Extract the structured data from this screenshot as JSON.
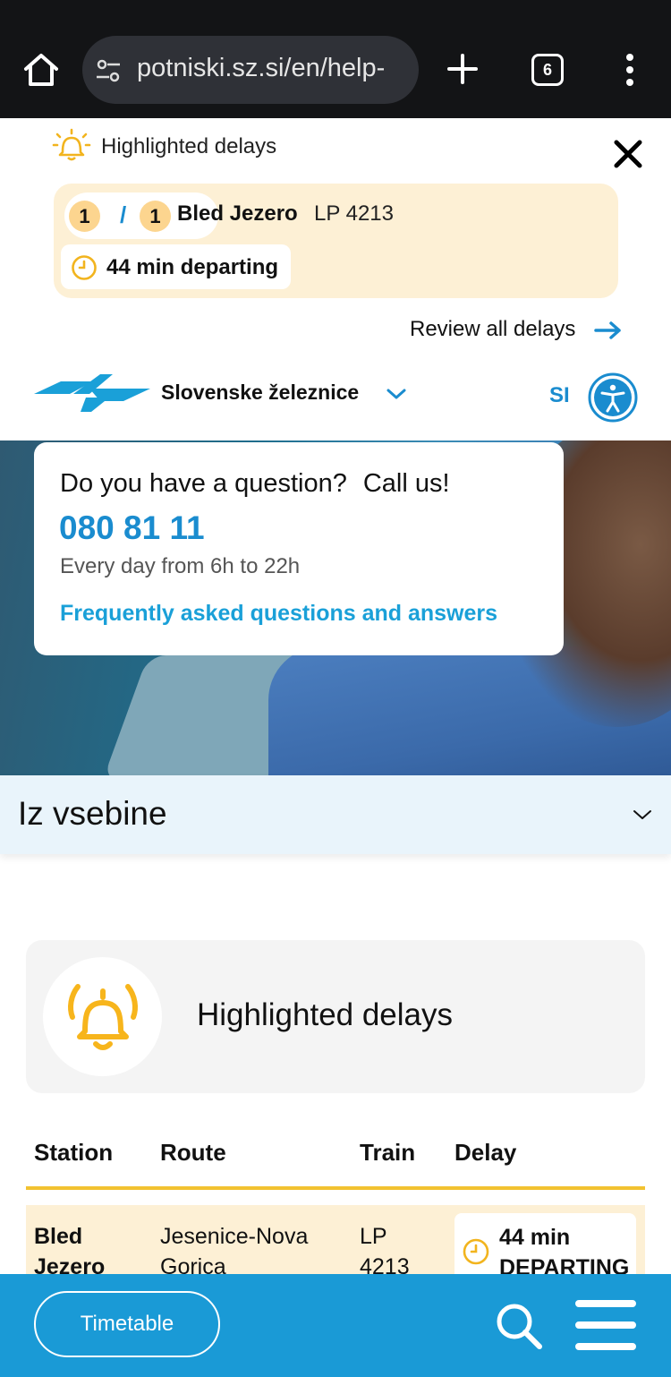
{
  "browser": {
    "url": "potniski.sz.si/en/help-",
    "tab_count": "6"
  },
  "banner": {
    "title": "Highlighted delays",
    "pager_current": "1",
    "pager_separator": "/",
    "pager_total": "1",
    "station": "Bled Jezero",
    "train": "LP 4213",
    "status": "44 min departing",
    "review_link": "Review all delays"
  },
  "header": {
    "brand": "Slovenske železnice",
    "language": "SI"
  },
  "contact": {
    "question": "Do you have a question?",
    "call_us": "Call us!",
    "phone": "080 81 11",
    "hours": "Every day from 6h to 22h",
    "faq_link": "Frequently asked questions and answers"
  },
  "accordion": {
    "title": "Iz vsebine"
  },
  "delays_section": {
    "title": "Highlighted delays",
    "columns": [
      "Station",
      "Route",
      "Train",
      "Delay"
    ],
    "rows": [
      {
        "station_line1": "Bled",
        "station_line2": "Jezero",
        "route_line1": "Jesenice-Nova",
        "route_line2": "Gorica",
        "train_line1": "LP",
        "train_line2": "4213",
        "delay_line1": "44 min",
        "delay_line2": "DEPARTING"
      }
    ]
  },
  "bottom_bar": {
    "timetable_label": "Timetable"
  },
  "colors": {
    "brand_blue": "#1a9ad6",
    "accent_yellow": "#f2c230",
    "delay_bg": "#fdf0d5"
  }
}
